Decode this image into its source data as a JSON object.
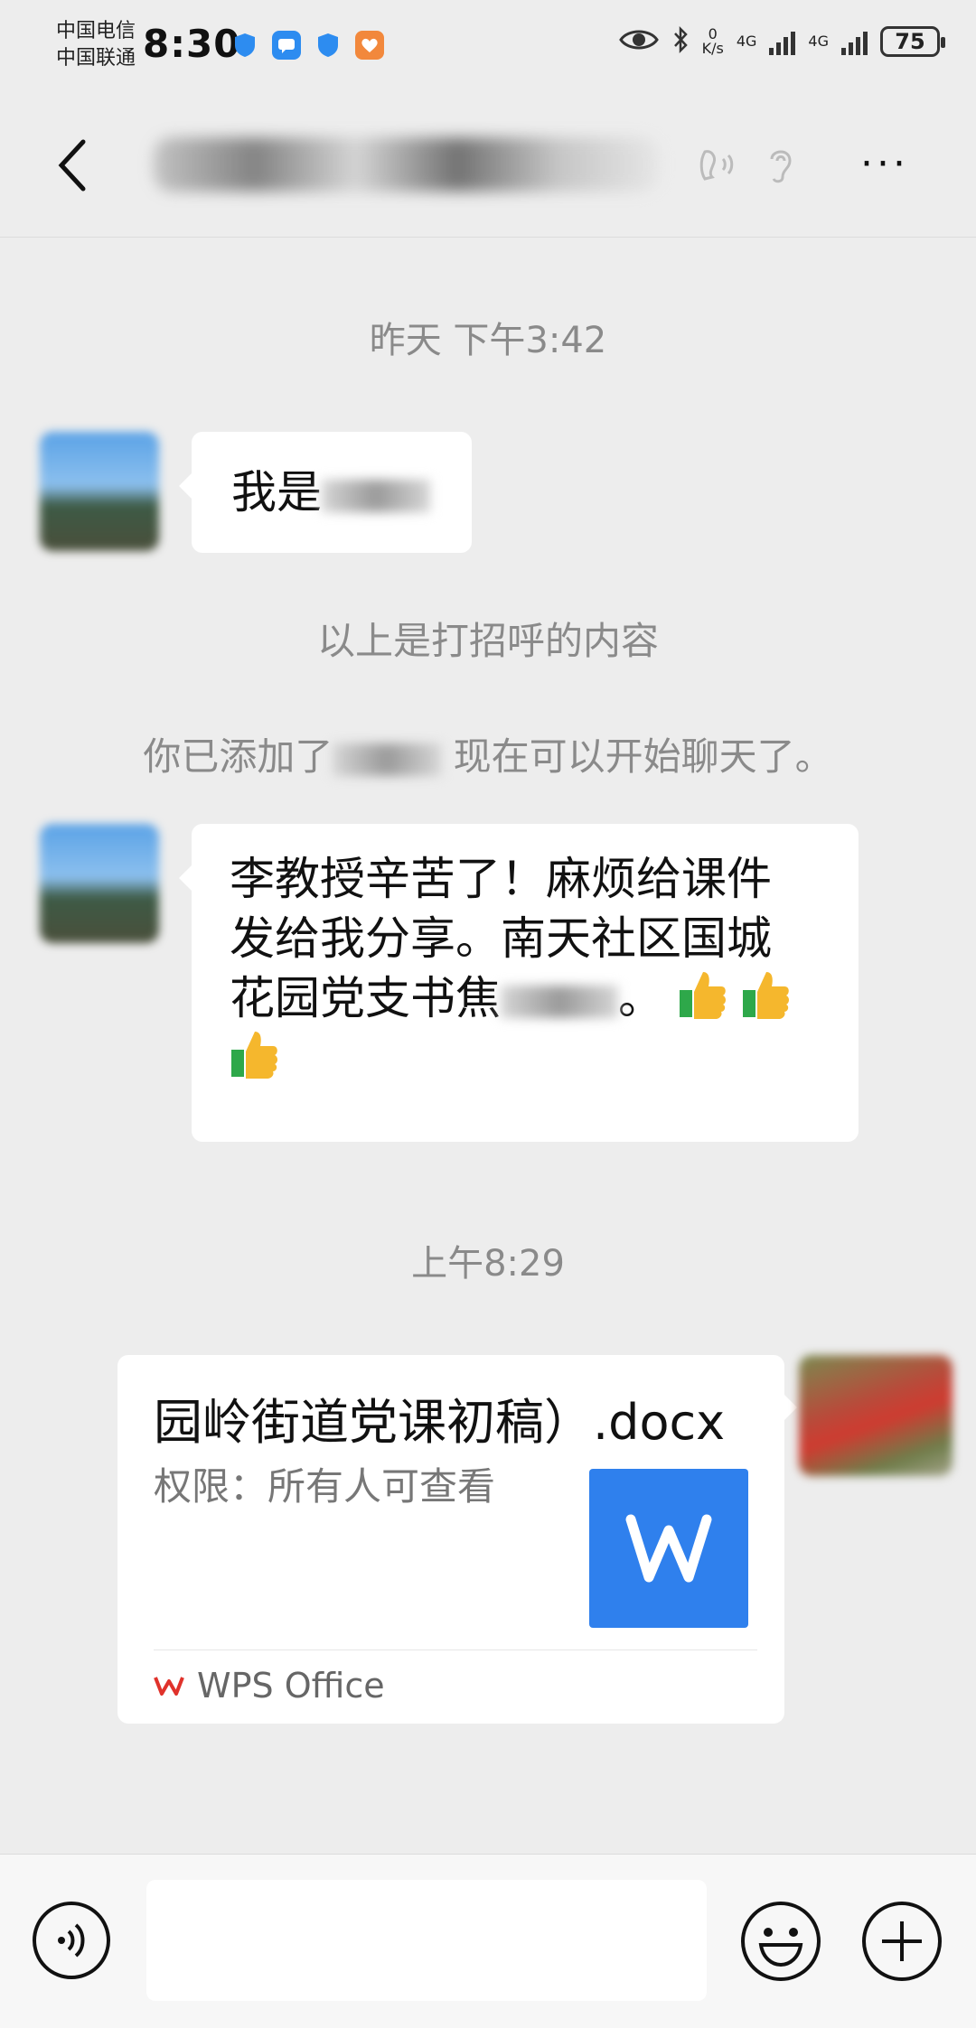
{
  "status_bar": {
    "carrier_1": "中国电信",
    "carrier_2": "中国联通",
    "time": "8:30",
    "net_speed_value": "0",
    "net_speed_unit": "K/s",
    "signal_1": "4G",
    "signal_2": "4G",
    "battery": "75"
  },
  "header": {
    "title": "",
    "back_icon": "chevron-left-icon",
    "more_label": "···"
  },
  "messages": {
    "ts_1": "昨天 下午3:42",
    "greeting": "我是",
    "notice_1": "以上是打招呼的内容",
    "notice_2_prefix": "你已添加了",
    "notice_2_suffix": " 现在可以开始聊天了。",
    "msg2_line1": "李教授辛苦了！麻烦给课件",
    "msg2_line2": "发给我分享。南天社区国城",
    "msg2_line3_prefix": "花园党支书焦",
    "msg2_line3_suffix": "。",
    "ts_2": "上午8:29"
  },
  "file_card": {
    "name": "园岭街道党课初稿）.docx",
    "permission": "权限：所有人可查看",
    "source": "WPS Office",
    "icon_letter": "W"
  },
  "input_bar": {
    "placeholder": ""
  },
  "colors": {
    "background": "#ededed",
    "bubble": "#ffffff",
    "file_icon": "#2f80ed",
    "wps_red": "#e0322b"
  }
}
